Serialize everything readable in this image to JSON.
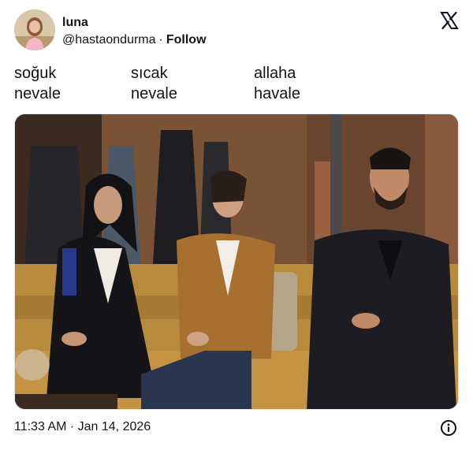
{
  "tweet": {
    "author_name": "luna",
    "author_handle": "@hastaondurma",
    "separator": "·",
    "follow_label": "Follow",
    "caption_columns": [
      {
        "line1": "soğuk",
        "line2": "nevale"
      },
      {
        "line1": "sıcak",
        "line2": "nevale"
      },
      {
        "line1": "allaha",
        "line2": "havale"
      }
    ],
    "timestamp": "11:33 AM · Jan 14, 2026"
  },
  "icons": {
    "platform_logo": "x-logo-icon",
    "info": "info-icon"
  },
  "colors": {
    "text_primary": "#0f1419",
    "background": "#ffffff",
    "border": "#e1e8ed"
  }
}
